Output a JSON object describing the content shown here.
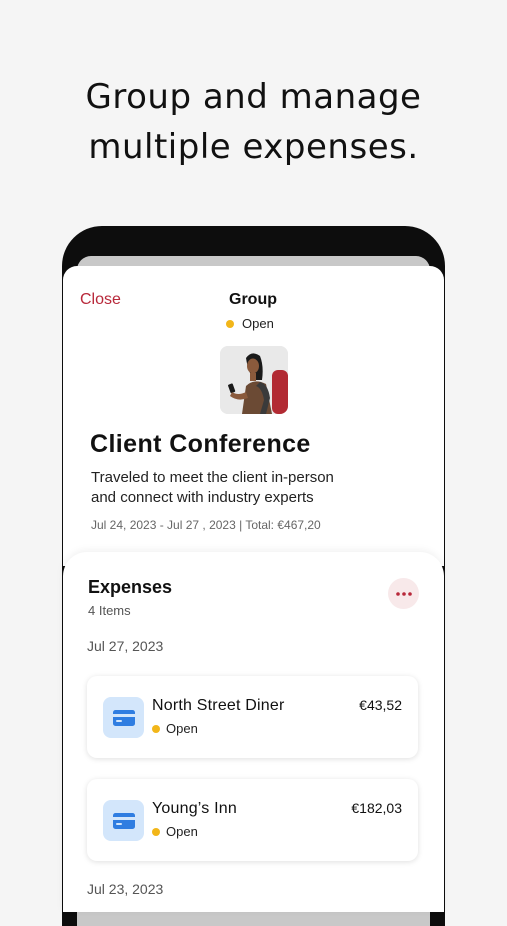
{
  "headline": {
    "line1": "Group and manage",
    "line2": "multiple expenses."
  },
  "group": {
    "close_label": "Close",
    "title": "Group",
    "status": "Open",
    "status_color": "#f2b619",
    "avatar_icon": "woman-with-phone-illustration",
    "trip_title": "Client Conference",
    "description_line1": "Traveled to meet the client in-person",
    "description_line2": "and connect with industry experts",
    "meta": "Jul 24, 2023 - Jul 27 , 2023 | Total: €467,20"
  },
  "expenses": {
    "title": "Expenses",
    "count": "4 Items",
    "more_icon": "more-horizontal-icon",
    "groups": [
      {
        "date": "Jul 27, 2023",
        "items": [
          {
            "name": "North Street Diner",
            "status": "Open",
            "amount": "€43,52",
            "icon": "credit-card-icon"
          },
          {
            "name": "Young’s Inn",
            "status": "Open",
            "amount": "€182,03",
            "icon": "credit-card-icon"
          }
        ]
      },
      {
        "date": "Jul 23, 2023",
        "items": []
      }
    ]
  },
  "colors": {
    "accent": "#b8283a",
    "card_icon_bg": "#d3e6fb",
    "card_icon": "#2f7de1",
    "status_open": "#f2b619"
  }
}
